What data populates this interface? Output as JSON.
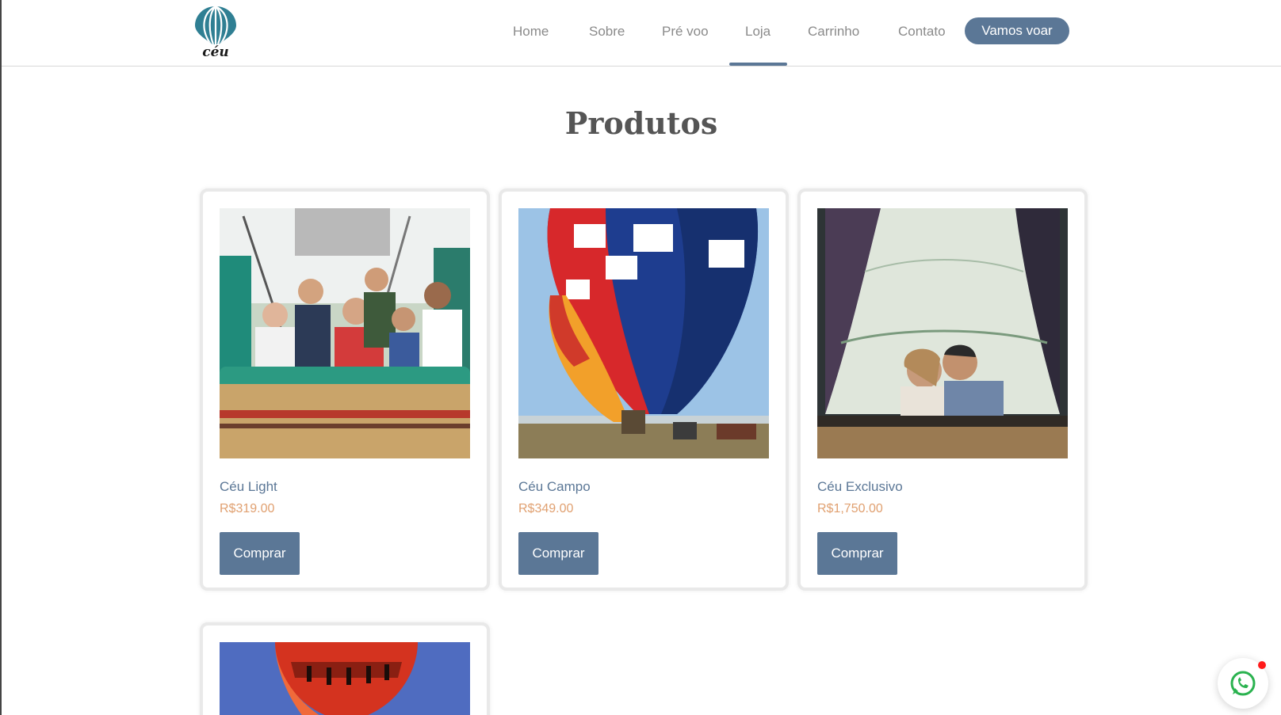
{
  "brand": {
    "logo_text": "céu"
  },
  "nav": {
    "items": [
      "Home",
      "Sobre",
      "Pré voo",
      "Loja",
      "Carrinho",
      "Contato"
    ],
    "active": "Loja",
    "cta_label": "Vamos voar"
  },
  "page": {
    "title": "Produtos"
  },
  "products": [
    {
      "name": "Céu Light",
      "price": "R$319.00",
      "button_label": "Comprar",
      "image": "balloon-basket-group-photo"
    },
    {
      "name": "Céu Campo",
      "price": "R$349.00",
      "button_label": "Comprar",
      "image": "colorful-balloon-photo"
    },
    {
      "name": "Céu Exclusivo",
      "price": "R$1,750.00",
      "button_label": "Comprar",
      "image": "couple-in-balloon-photo"
    },
    {
      "image": "red-balloon-photo"
    }
  ],
  "chat": {
    "icon": "whatsapp-icon"
  },
  "colors": {
    "primary": "#5b7796",
    "price": "#e0a070",
    "nav_text": "#8a8a8a",
    "notification": "#ff1a1a"
  }
}
